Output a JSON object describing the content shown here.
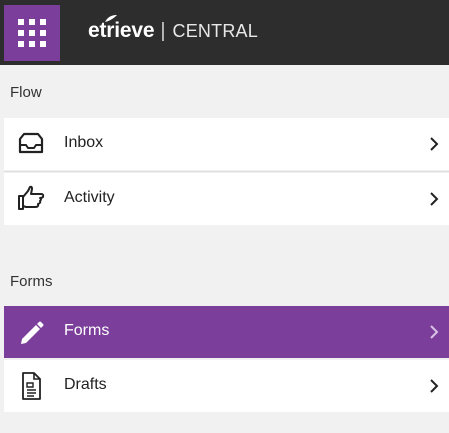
{
  "header": {
    "brand_logo": "etrieve",
    "brand_separator": "|",
    "brand_product": "CENTRAL",
    "app_launcher_icon": "grid-icon",
    "brand_color": "#7b3f9b",
    "header_color": "#2d2d2d"
  },
  "sections": [
    {
      "label": "Flow",
      "items": [
        {
          "label": "Inbox",
          "icon": "inbox-tray-icon",
          "active": false
        },
        {
          "label": "Activity",
          "icon": "hand-pointing-icon",
          "active": false
        }
      ]
    },
    {
      "label": "Forms",
      "items": [
        {
          "label": "Forms",
          "icon": "pencil-icon",
          "active": true
        },
        {
          "label": "Drafts",
          "icon": "document-icon",
          "active": false
        }
      ]
    }
  ],
  "chevron_icon": "chevron-right-icon"
}
